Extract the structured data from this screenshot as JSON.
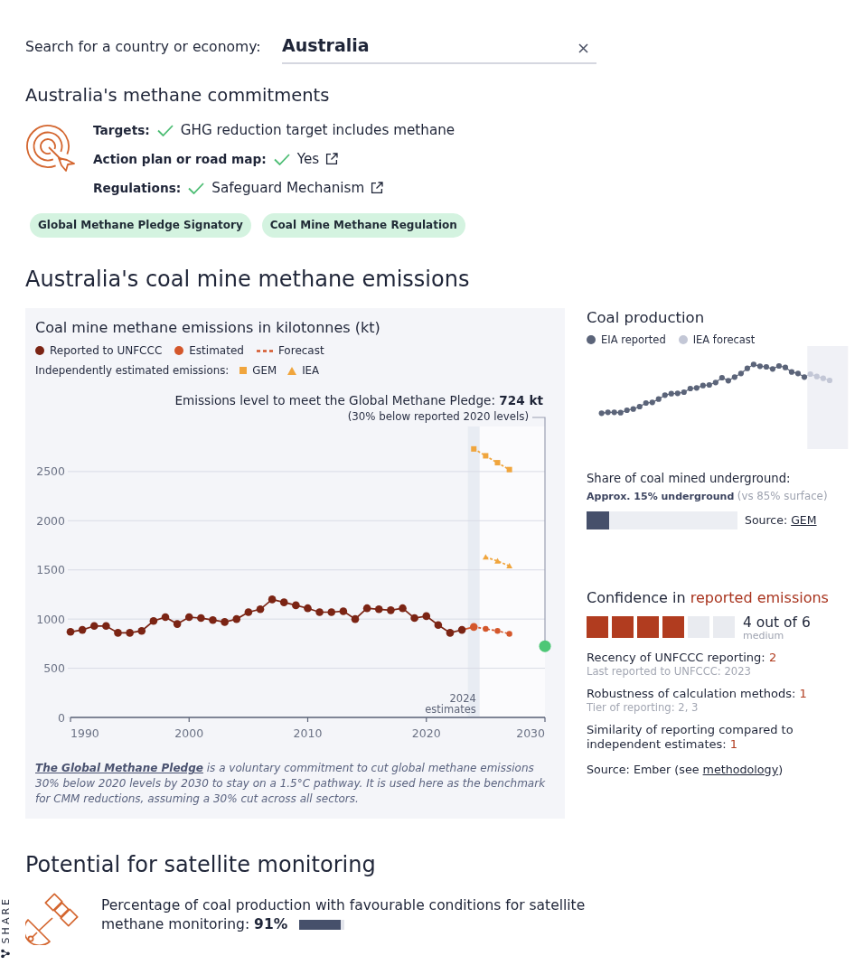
{
  "search": {
    "label": "Search for a country or economy:",
    "value": "Australia"
  },
  "commitments": {
    "title": "Australia's methane commitments",
    "rows": [
      {
        "label": "Targets:",
        "value": "GHG reduction target includes methane",
        "met": true,
        "external_link": false
      },
      {
        "label": "Action plan or road map:",
        "value": "Yes",
        "met": true,
        "external_link": true
      },
      {
        "label": "Regulations:",
        "value": "Safeguard Mechanism",
        "met": true,
        "external_link": true
      }
    ],
    "tags": [
      "Global Methane Pledge Signatory",
      "Coal Mine Methane Regulation"
    ]
  },
  "emissions": {
    "title": "Australia's coal mine methane emissions",
    "chart": {
      "independent_label": "Independently estimated emissions:",
      "chart_data": {
        "type": "line",
        "title": "Coal mine methane emissions in kilotonnes (kt)",
        "legend": "top",
        "grid": true,
        "x": [
          1990,
          1991,
          1992,
          1993,
          1994,
          1995,
          1996,
          1997,
          1998,
          1999,
          2000,
          2001,
          2002,
          2003,
          2004,
          2005,
          2006,
          2007,
          2008,
          2009,
          2010,
          2011,
          2012,
          2013,
          2014,
          2015,
          2016,
          2017,
          2018,
          2019,
          2020,
          2021,
          2022,
          2023,
          2024,
          2025,
          2026,
          2027,
          2030
        ],
        "series": [
          {
            "name": "Reported to UNFCCC",
            "color": "#7b2414",
            "marker": "circle",
            "values": [
              870,
              890,
              930,
              930,
              860,
              860,
              880,
              980,
              1020,
              950,
              1020,
              1010,
              990,
              970,
              1000,
              1070,
              1100,
              1200,
              1170,
              1140,
              1110,
              1070,
              1070,
              1080,
              1000,
              1110,
              1100,
              1090,
              1110,
              1010,
              1030,
              940,
              860,
              890,
              null,
              null,
              null,
              null,
              null
            ]
          },
          {
            "name": "Estimated",
            "color": "#d4572b",
            "marker": "circle",
            "values": [
              null,
              null,
              null,
              null,
              null,
              null,
              null,
              null,
              null,
              null,
              null,
              null,
              null,
              null,
              null,
              null,
              null,
              null,
              null,
              null,
              null,
              null,
              null,
              null,
              null,
              null,
              null,
              null,
              null,
              null,
              null,
              null,
              null,
              890,
              920,
              null,
              null,
              null,
              null
            ]
          },
          {
            "name": "Forecast",
            "color": "#d4572b",
            "marker": "circle",
            "line_style": "dashed",
            "values": [
              null,
              null,
              null,
              null,
              null,
              null,
              null,
              null,
              null,
              null,
              null,
              null,
              null,
              null,
              null,
              null,
              null,
              null,
              null,
              null,
              null,
              null,
              null,
              null,
              null,
              null,
              null,
              null,
              null,
              null,
              null,
              null,
              null,
              null,
              920,
              900,
              880,
              850,
              null
            ]
          },
          {
            "name": "GEM",
            "color": "#f0a53d",
            "marker": "square",
            "line_style": "dashed",
            "values": [
              null,
              null,
              null,
              null,
              null,
              null,
              null,
              null,
              null,
              null,
              null,
              null,
              null,
              null,
              null,
              null,
              null,
              null,
              null,
              null,
              null,
              null,
              null,
              null,
              null,
              null,
              null,
              null,
              null,
              null,
              null,
              null,
              null,
              null,
              2730,
              2660,
              2590,
              2520,
              null
            ]
          },
          {
            "name": "IEA",
            "color": "#f0a53d",
            "marker": "triangle",
            "line_style": "dashed",
            "values": [
              null,
              null,
              null,
              null,
              null,
              null,
              null,
              null,
              null,
              null,
              null,
              null,
              null,
              null,
              null,
              null,
              null,
              null,
              null,
              null,
              null,
              null,
              null,
              null,
              null,
              null,
              null,
              null,
              null,
              null,
              null,
              null,
              null,
              null,
              null,
              1630,
              1590,
              1540,
              null
            ]
          },
          {
            "color": "#4dc776",
            "marker": "circle",
            "values": [
              null,
              null,
              null,
              null,
              null,
              null,
              null,
              null,
              null,
              null,
              null,
              null,
              null,
              null,
              null,
              null,
              null,
              null,
              null,
              null,
              null,
              null,
              null,
              null,
              null,
              null,
              null,
              null,
              null,
              null,
              null,
              null,
              null,
              null,
              null,
              null,
              null,
              null,
              724
            ]
          }
        ],
        "xlim": [
          1990,
          2030
        ],
        "ylim": [
          0,
          3050
        ],
        "xticks": [
          1990,
          2000,
          2010,
          2020,
          2030
        ],
        "yticks": [
          0,
          500,
          1000,
          1500,
          2000,
          2500
        ],
        "bands": [
          {
            "axis": "x",
            "from": 2023.5,
            "to": 2024.5,
            "label": "2024 estimates"
          },
          {
            "axis": "x",
            "from": 2024.5,
            "to": 2030
          }
        ],
        "annotations": [
          "Emissions level to meet the Global Methane Pledge: **724 kt**\n(30% below reported 2020 levels)"
        ]
      },
      "footnote": {
        "link": "The Global Methane Pledge",
        "text": "is a voluntary commitment to cut global methane emissions 30% below 2020 levels by 2030 to stay on a 1.5°C pathway. It is used here as the benchmark for CMM reductions, assuming a 30% cut across all sectors."
      }
    },
    "production": {
      "title": "Coal production",
      "legend": [
        {
          "label": "EIA reported",
          "color": "#5b6479"
        },
        {
          "label": "IEA forecast",
          "color": "#c3c7d6"
        }
      ]
    },
    "underground": {
      "label": "Share of coal mined underground:",
      "value": "Approx. 15% underground",
      "note": "(vs 85% surface)",
      "level": 0.15,
      "source_label": "Source:",
      "source_link": "GEM"
    },
    "confidence": {
      "title": "Confidence in",
      "title_highlight": "reported emissions",
      "blocks": [
        {
          "filled": true
        },
        {
          "filled": true
        },
        {
          "filled": true
        },
        {
          "filled": true
        },
        {
          "filled": false
        },
        {
          "filled": false
        }
      ],
      "score": "4 out of 6",
      "rating": "medium",
      "criteria": [
        {
          "label": "Recency of UNFCCC reporting:",
          "score": "2",
          "note": "Last reported to UNFCCC: 2023"
        },
        {
          "label": "Robustness of calculation methods:",
          "score": "1",
          "note": "Tier of reporting: 2, 3"
        },
        {
          "label": "Similarity of reporting compared to independent estimates:",
          "score": "1"
        }
      ],
      "source": {
        "before": "Source: Ember (see",
        "link": "methodology",
        "after": ")"
      }
    }
  },
  "satellite": {
    "title": "Potential for satellite monitoring",
    "text": "Percentage of coal production with favourable conditions for satellite methane monitoring:",
    "value": "91%",
    "level": 0.91
  },
  "share": {
    "label": "SHARE"
  }
}
